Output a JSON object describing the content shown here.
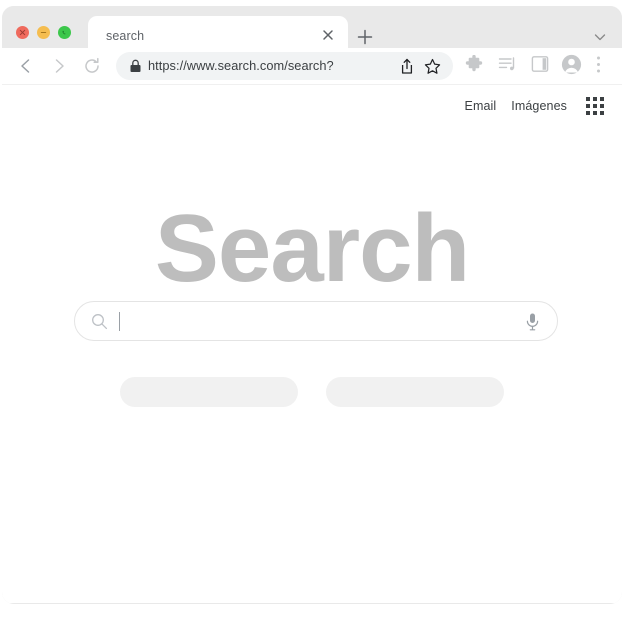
{
  "window": {
    "traffic_lights": [
      {
        "name": "close",
        "color": "#ef6a5d",
        "glyph": "close-icon"
      },
      {
        "name": "minimize",
        "color": "#f5bd4f",
        "glyph": "minus-icon"
      },
      {
        "name": "maximize",
        "color": "#3cc74b",
        "glyph": "phone-icon"
      }
    ]
  },
  "tabstrip": {
    "tab_title": "search",
    "close_icon": "close-icon",
    "new_tab_icon": "plus-icon",
    "tab_list_icon": "chevron-down-icon"
  },
  "toolbar": {
    "back_icon": "arrow-left-icon",
    "forward_icon": "arrow-right-icon",
    "reload_icon": "reload-icon",
    "lock_icon": "lock-icon",
    "url": "https://www.search.com/search?",
    "share_icon": "share-icon",
    "bookmark_icon": "star-icon",
    "extensions_icon": "puzzle-icon",
    "media_icon": "media-playlist-icon",
    "panel_icon": "side-panel-icon",
    "profile_icon": "account-avatar-icon",
    "menu_icon": "three-dot-menu-icon"
  },
  "page": {
    "header_links": [
      "Email",
      "Imágenes"
    ],
    "apps_icon": "apps-grid-icon",
    "logo_text": "Search",
    "search": {
      "value": "",
      "placeholder": "",
      "search_icon": "magnifier-icon",
      "mic_icon": "microphone-icon"
    },
    "buttons": [
      {
        "label": ""
      },
      {
        "label": ""
      }
    ]
  },
  "colors": {
    "chrome_bg": "#e9e9e9",
    "page_bg": "#ffffff",
    "omnibox_bg": "#f1f3f4",
    "logo_gray": "#bdbdbd",
    "ghost_btn": "#f1f1f1",
    "text": "#3c4043"
  }
}
